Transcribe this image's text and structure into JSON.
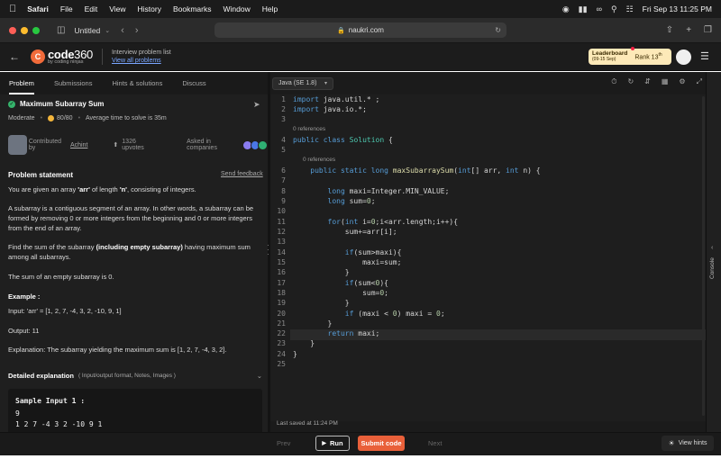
{
  "menubar": {
    "app": "Safari",
    "menus": [
      "File",
      "Edit",
      "View",
      "History",
      "Bookmarks",
      "Window",
      "Help"
    ],
    "datetime": "Fri Sep 13  11:25 PM"
  },
  "browser": {
    "tab_title": "Untitled",
    "url": "naukri.com"
  },
  "header": {
    "logo_main": "code",
    "logo_num": "360",
    "logo_sub": "by coding ninjas",
    "crumb_parent": "Interview problem list",
    "crumb_link": "View all problems",
    "leaderboard_title": "Leaderboard",
    "leaderboard_dates": "(09-15 Sep)",
    "rank_label": "Rank",
    "rank_value": "13",
    "rank_suffix": "th"
  },
  "left_tabs": [
    "Problem",
    "Submissions",
    "Hints & solutions",
    "Discuss"
  ],
  "problem": {
    "title": "Maximum Subarray Sum",
    "difficulty": "Moderate",
    "score": "80/80",
    "avg_time": "Average time to solve is 35m",
    "contributed_by": "Contributed by",
    "author": "Achint",
    "upvotes": "1326 upvotes",
    "asked_in": "Asked in companies",
    "statement_header": "Problem statement",
    "send_feedback": "Send feedback",
    "example_header": "Example :",
    "input_line": "Input: 'arr' = [1, 2, 7, -4, 3, 2, -10, 9, 1]",
    "output_line": "Output: 11",
    "explanation_line": "Explanation: The subarray yielding the maximum sum is [1, 2, 7, -4, 3, 2].",
    "detailed_header": "Detailed explanation",
    "detailed_sub": "( Input/output format, Notes, Images )",
    "sample_header": "Sample Input 1 :",
    "sample_line1": "9",
    "sample_line2": "1 2 7 -4 3 2 -10 9 1"
  },
  "editor": {
    "language": "Java (SE 1.8)",
    "refs1": "0 references",
    "refs2": "0 references",
    "last_saved": "Last saved at 11:24 PM",
    "line_numbers": [
      "1",
      "2",
      "3",
      "4",
      "5",
      "6",
      "7",
      "8",
      "9",
      "10",
      "11",
      "12",
      "13",
      "14",
      "15",
      "16",
      "17",
      "18",
      "19",
      "20",
      "21",
      "22",
      "23",
      "24",
      "25"
    ]
  },
  "bottom": {
    "prev": "Prev",
    "run": "Run",
    "submit": "Submit code",
    "next": "Next",
    "hints": "View hints"
  },
  "console_label": "Console"
}
